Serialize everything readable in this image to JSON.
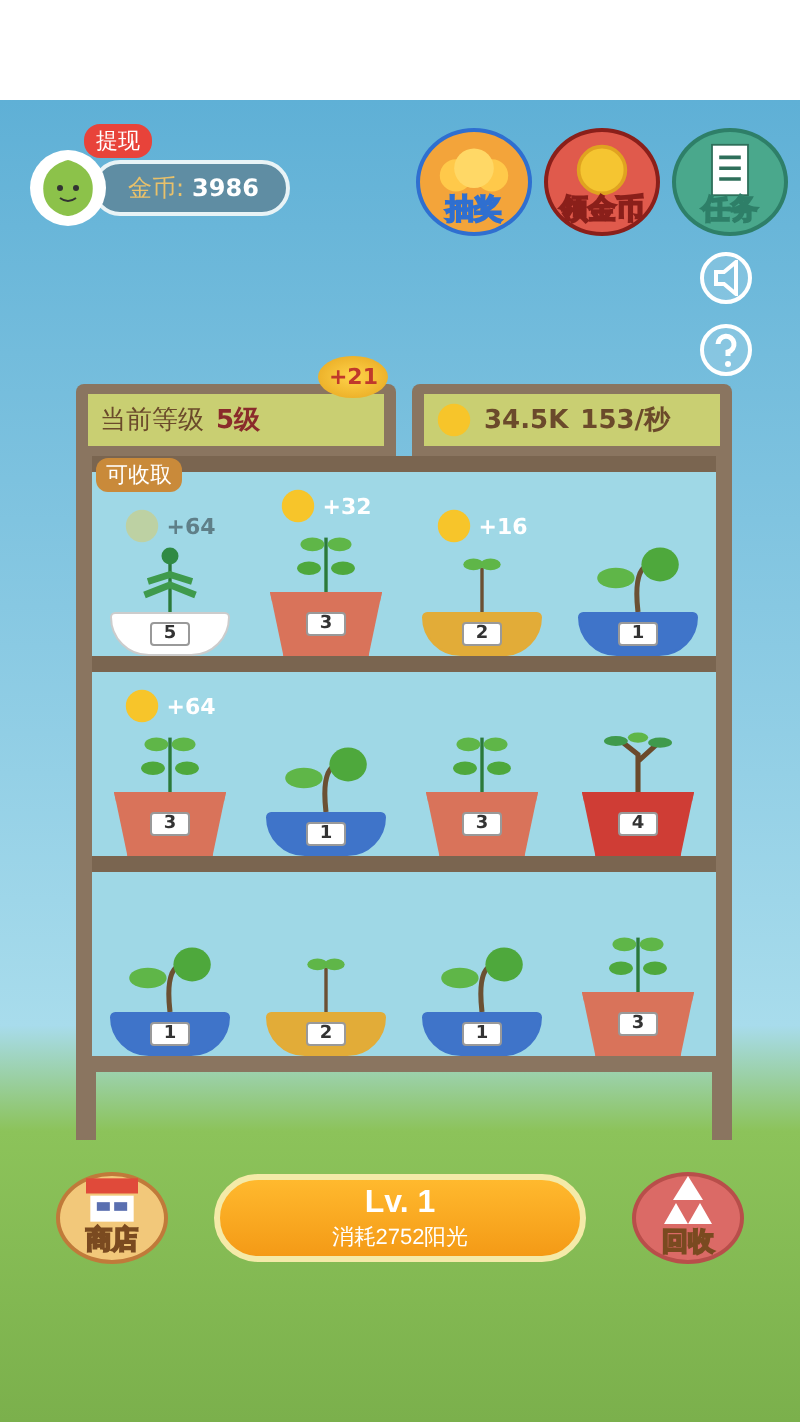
{
  "profile": {
    "badge": "提现",
    "coins_label": "金币:",
    "coins": "3986"
  },
  "top_buttons": [
    {
      "kind": "lottery",
      "label": "抽奖"
    },
    {
      "kind": "coin",
      "label": "领金币"
    },
    {
      "kind": "tasks",
      "label": "任务"
    }
  ],
  "side_buttons": [
    {
      "kind": "sound"
    },
    {
      "kind": "help"
    }
  ],
  "level_panel": {
    "label": "当前等级",
    "value": "5级",
    "bonus": "+21",
    "hint": "可收取"
  },
  "sun_panel": {
    "total": "34.5K",
    "rate": "153/秒"
  },
  "shelves": [
    [
      {
        "kind": "bowl",
        "color": "#ffffff",
        "plant": {
          "kind": "flower"
        },
        "grade": "5",
        "reward": "+64",
        "faded": true
      },
      {
        "kind": "pot",
        "color": "#d9735a",
        "plant": {
          "kind": "leafy"
        },
        "grade": "3",
        "reward": "+32",
        "faded": false
      },
      {
        "kind": "bowl",
        "color": "#e2ac38",
        "plant": {
          "kind": "seedling"
        },
        "grade": "2",
        "reward": "+16",
        "faded": false
      },
      {
        "kind": "bowl",
        "color": "#3f74c9",
        "plant": {
          "kind": "sprout"
        },
        "grade": "1"
      }
    ],
    [
      {
        "kind": "pot",
        "color": "#d9735a",
        "plant": {
          "kind": "leafy"
        },
        "grade": "3",
        "reward": "+64",
        "faded": false
      },
      {
        "kind": "bowl",
        "color": "#3f74c9",
        "plant": {
          "kind": "sprout"
        },
        "grade": "1"
      },
      {
        "kind": "pot",
        "color": "#d9735a",
        "plant": {
          "kind": "leafy"
        },
        "grade": "3"
      },
      {
        "kind": "pot",
        "color": "#cf3d35",
        "plant": {
          "kind": "tree"
        },
        "grade": "4"
      }
    ],
    [
      {
        "kind": "bowl",
        "color": "#3f74c9",
        "plant": {
          "kind": "sprout"
        },
        "grade": "1"
      },
      {
        "kind": "bowl",
        "color": "#e2ac38",
        "plant": {
          "kind": "seedling"
        },
        "grade": "2"
      },
      {
        "kind": "bowl",
        "color": "#3f74c9",
        "plant": {
          "kind": "sprout"
        },
        "grade": "1"
      },
      {
        "kind": "pot",
        "color": "#d9735a",
        "plant": {
          "kind": "leafy"
        },
        "grade": "3"
      }
    ]
  ],
  "bottom": {
    "shop": "商店",
    "upgrade_title": "Lv. 1",
    "upgrade_cost": "消耗2752阳光",
    "recycle": "回收"
  }
}
